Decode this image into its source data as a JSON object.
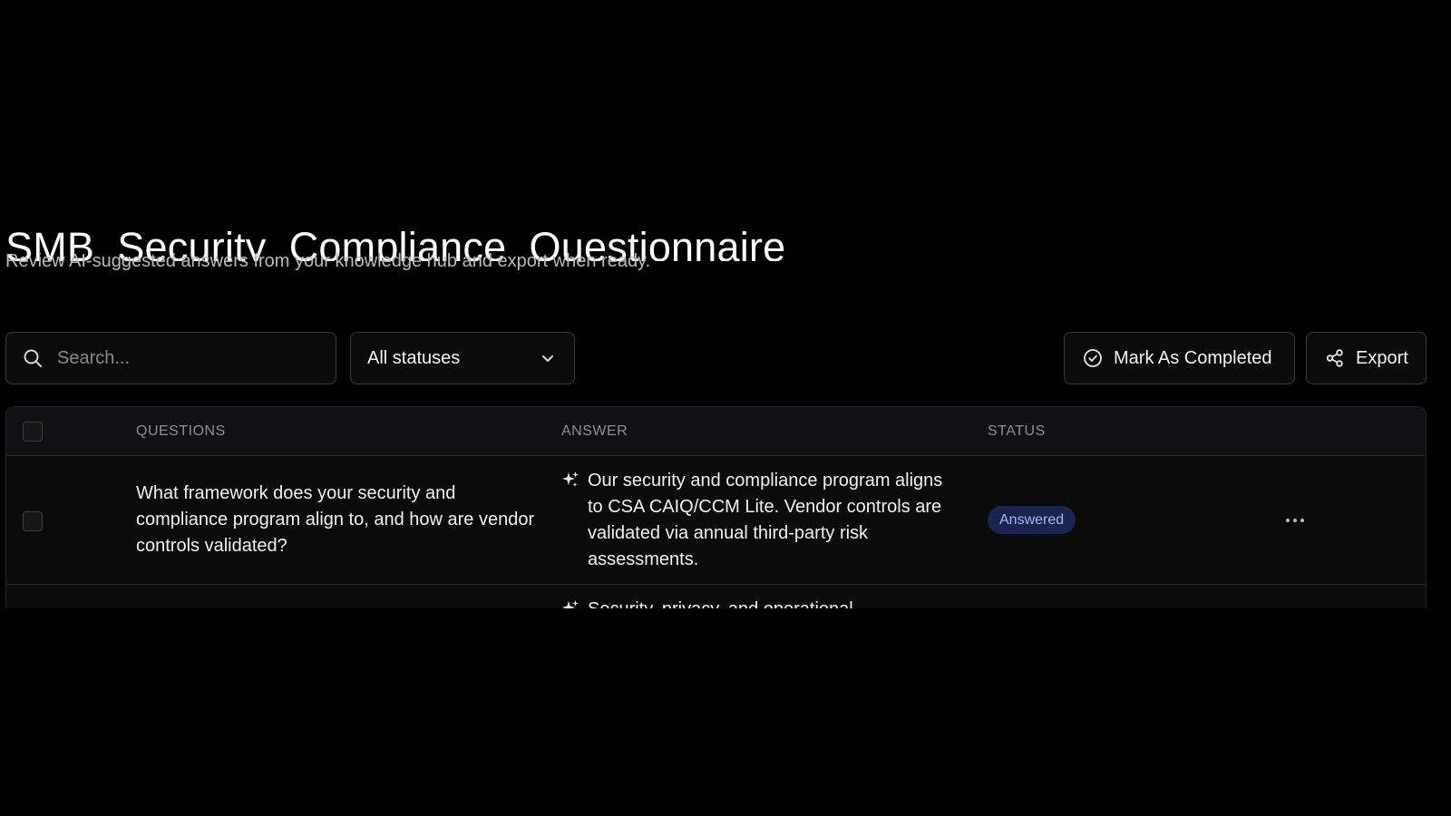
{
  "header": {
    "title": "SMB_Security_Compliance_Questionnaire",
    "subtitle": "Review AI-suggested answers from your knowledge hub and export when ready."
  },
  "toolbar": {
    "search_placeholder": "Search...",
    "search_icon": "search-icon",
    "status_filter": {
      "selected": "All statuses",
      "icon": "chevron-down-icon"
    },
    "mark_completed_label": "Mark As Completed",
    "mark_completed_icon": "check-circle-icon",
    "export_label": "Export",
    "export_icon": "share-icon"
  },
  "table": {
    "columns": [
      "QUESTIONS",
      "ANSWER",
      "STATUS"
    ],
    "rows": [
      {
        "question": "What framework does your security and compliance program align to, and how are vendor controls validated?",
        "answer": "Our security and compliance program aligns to CSA CAIQ/CCM Lite. Vendor controls are validated via annual third-party risk assessments.",
        "answer_icon": "sparkle-icon",
        "status": "Answered",
        "actions_icon": "more-horizontal-icon"
      },
      {
        "question": "",
        "answer": "Security, privacy, and operational",
        "answer_icon": "sparkle-icon",
        "status": "",
        "actions_icon": ""
      }
    ]
  },
  "colors": {
    "background": "#000000",
    "badge_background": "#1b2450",
    "badge_text": "#aab6ee",
    "border": "#3a3a3a"
  }
}
